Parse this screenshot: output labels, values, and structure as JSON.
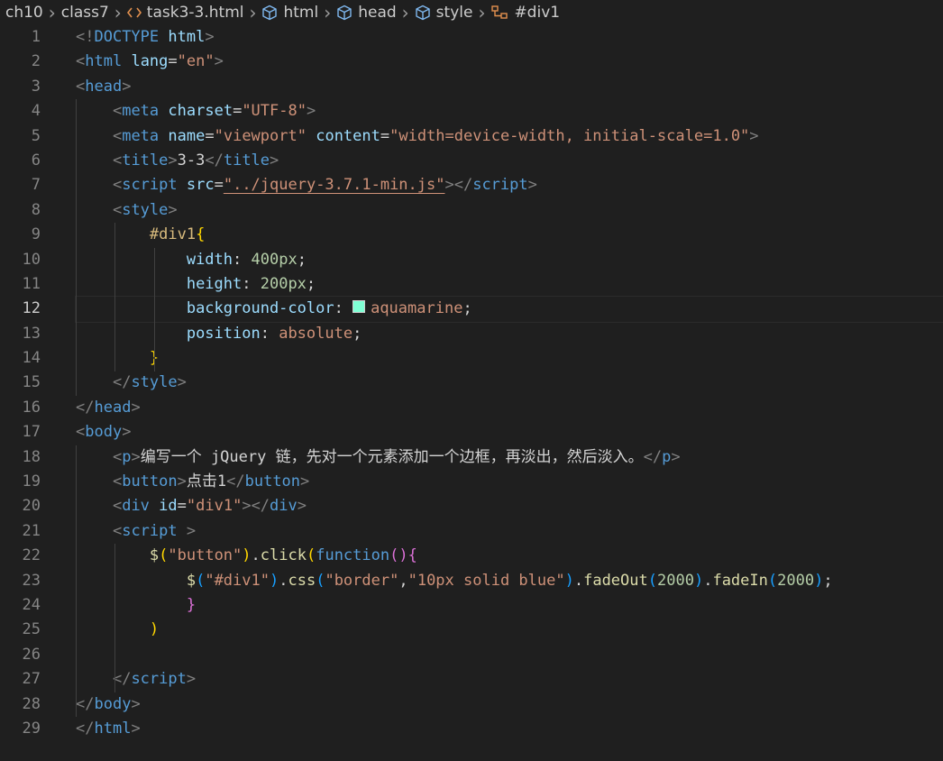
{
  "breadcrumb": {
    "items": [
      "ch10",
      "class7",
      "task3-3.html",
      "html",
      "head",
      "style",
      "#div1"
    ],
    "icons": [
      "",
      "",
      "code-icon",
      "cube-icon",
      "cube-icon",
      "cube-icon",
      "css-selector-icon"
    ]
  },
  "editor": {
    "current_line": 12,
    "swatch_color": "#7fffd4",
    "lines": [
      [
        [
          "pun",
          "<!"
        ],
        [
          "tag",
          "DOCTYPE"
        ],
        [
          "txt",
          " "
        ],
        [
          "attr",
          "html"
        ],
        [
          "pun",
          ">"
        ]
      ],
      [
        [
          "pun",
          "<"
        ],
        [
          "tag",
          "html"
        ],
        [
          "txt",
          " "
        ],
        [
          "attr",
          "lang"
        ],
        [
          "txt",
          "="
        ],
        [
          "str",
          "\"en\""
        ],
        [
          "pun",
          ">"
        ]
      ],
      [
        [
          "pun",
          "<"
        ],
        [
          "tag",
          "head"
        ],
        [
          "pun",
          ">"
        ]
      ],
      [
        [
          "txt",
          "    "
        ],
        [
          "pun",
          "<"
        ],
        [
          "tag",
          "meta"
        ],
        [
          "txt",
          " "
        ],
        [
          "attr",
          "charset"
        ],
        [
          "txt",
          "="
        ],
        [
          "str",
          "\"UTF-8\""
        ],
        [
          "pun",
          ">"
        ]
      ],
      [
        [
          "txt",
          "    "
        ],
        [
          "pun",
          "<"
        ],
        [
          "tag",
          "meta"
        ],
        [
          "txt",
          " "
        ],
        [
          "attr",
          "name"
        ],
        [
          "txt",
          "="
        ],
        [
          "str",
          "\"viewport\""
        ],
        [
          "txt",
          " "
        ],
        [
          "attr",
          "content"
        ],
        [
          "txt",
          "="
        ],
        [
          "str",
          "\"width=device-width, initial-scale=1.0\""
        ],
        [
          "pun",
          ">"
        ]
      ],
      [
        [
          "txt",
          "    "
        ],
        [
          "pun",
          "<"
        ],
        [
          "tag",
          "title"
        ],
        [
          "pun",
          ">"
        ],
        [
          "txt",
          "3-3"
        ],
        [
          "pun",
          "</"
        ],
        [
          "tag",
          "title"
        ],
        [
          "pun",
          ">"
        ]
      ],
      [
        [
          "txt",
          "    "
        ],
        [
          "pun",
          "<"
        ],
        [
          "tag",
          "script"
        ],
        [
          "txt",
          " "
        ],
        [
          "attr",
          "src"
        ],
        [
          "txt",
          "="
        ],
        [
          "link",
          "\"../jquery-3.7.1-min.js\""
        ],
        [
          "pun",
          "></"
        ],
        [
          "tag",
          "script"
        ],
        [
          "pun",
          ">"
        ]
      ],
      [
        [
          "txt",
          "    "
        ],
        [
          "pun",
          "<"
        ],
        [
          "tag",
          "style"
        ],
        [
          "pun",
          ">"
        ]
      ],
      [
        [
          "txt",
          "        "
        ],
        [
          "sel",
          "#div1"
        ],
        [
          "br1",
          "{"
        ]
      ],
      [
        [
          "txt",
          "            "
        ],
        [
          "prop",
          "width"
        ],
        [
          "txt",
          ": "
        ],
        [
          "num",
          "400px"
        ],
        [
          "txt",
          ";"
        ]
      ],
      [
        [
          "txt",
          "            "
        ],
        [
          "prop",
          "height"
        ],
        [
          "txt",
          ": "
        ],
        [
          "num",
          "200px"
        ],
        [
          "txt",
          ";"
        ]
      ],
      [
        [
          "txt",
          "            "
        ],
        [
          "prop",
          "background-color"
        ],
        [
          "txt",
          ": "
        ],
        [
          "swatch",
          ""
        ],
        [
          "val",
          "aquamarine"
        ],
        [
          "txt",
          ";"
        ]
      ],
      [
        [
          "txt",
          "            "
        ],
        [
          "prop",
          "position"
        ],
        [
          "txt",
          ": "
        ],
        [
          "val",
          "absolute"
        ],
        [
          "txt",
          ";"
        ]
      ],
      [
        [
          "txt",
          "        "
        ],
        [
          "br1",
          "}"
        ]
      ],
      [
        [
          "txt",
          "    "
        ],
        [
          "pun",
          "</"
        ],
        [
          "tag",
          "style"
        ],
        [
          "pun",
          ">"
        ]
      ],
      [
        [
          "pun",
          "</"
        ],
        [
          "tag",
          "head"
        ],
        [
          "pun",
          ">"
        ]
      ],
      [
        [
          "pun",
          "<"
        ],
        [
          "tag",
          "body"
        ],
        [
          "pun",
          ">"
        ]
      ],
      [
        [
          "txt",
          "    "
        ],
        [
          "pun",
          "<"
        ],
        [
          "tag",
          "p"
        ],
        [
          "pun",
          ">"
        ],
        [
          "txt",
          "编写一个 jQuery 链，先对一个元素添加一个边框，再淡出，然后淡入。"
        ],
        [
          "pun",
          "</"
        ],
        [
          "tag",
          "p"
        ],
        [
          "pun",
          ">"
        ]
      ],
      [
        [
          "txt",
          "    "
        ],
        [
          "pun",
          "<"
        ],
        [
          "tag",
          "button"
        ],
        [
          "pun",
          ">"
        ],
        [
          "txt",
          "点击1"
        ],
        [
          "pun",
          "</"
        ],
        [
          "tag",
          "button"
        ],
        [
          "pun",
          ">"
        ]
      ],
      [
        [
          "txt",
          "    "
        ],
        [
          "pun",
          "<"
        ],
        [
          "tag",
          "div"
        ],
        [
          "txt",
          " "
        ],
        [
          "attr",
          "id"
        ],
        [
          "txt",
          "="
        ],
        [
          "str",
          "\"div1\""
        ],
        [
          "pun",
          "></"
        ],
        [
          "tag",
          "div"
        ],
        [
          "pun",
          ">"
        ]
      ],
      [
        [
          "txt",
          "    "
        ],
        [
          "pun",
          "<"
        ],
        [
          "tag",
          "script"
        ],
        [
          "txt",
          " "
        ],
        [
          "pun",
          ">"
        ]
      ],
      [
        [
          "txt",
          "        "
        ],
        [
          "fn",
          "$"
        ],
        [
          "br1",
          "("
        ],
        [
          "str",
          "\"button\""
        ],
        [
          "br1",
          ")"
        ],
        [
          "txt",
          "."
        ],
        [
          "fn",
          "click"
        ],
        [
          "br1",
          "("
        ],
        [
          "kw",
          "function"
        ],
        [
          "br2",
          "()"
        ],
        [
          "br2",
          "{"
        ]
      ],
      [
        [
          "txt",
          "            "
        ],
        [
          "fn",
          "$"
        ],
        [
          "br3",
          "("
        ],
        [
          "str",
          "\"#div1\""
        ],
        [
          "br3",
          ")"
        ],
        [
          "txt",
          "."
        ],
        [
          "fn",
          "css"
        ],
        [
          "br3",
          "("
        ],
        [
          "str",
          "\"border\""
        ],
        [
          "txt",
          ","
        ],
        [
          "str",
          "\"10px solid blue\""
        ],
        [
          "br3",
          ")"
        ],
        [
          "txt",
          "."
        ],
        [
          "fn",
          "fadeOut"
        ],
        [
          "br3",
          "("
        ],
        [
          "num",
          "2000"
        ],
        [
          "br3",
          ")"
        ],
        [
          "txt",
          "."
        ],
        [
          "fn",
          "fadeIn"
        ],
        [
          "br3",
          "("
        ],
        [
          "num",
          "2000"
        ],
        [
          "br3",
          ")"
        ],
        [
          "txt",
          ";"
        ]
      ],
      [
        [
          "txt",
          "            "
        ],
        [
          "br2",
          "}"
        ]
      ],
      [
        [
          "txt",
          "        "
        ],
        [
          "br1",
          ")"
        ]
      ],
      [
        [
          "txt",
          ""
        ]
      ],
      [
        [
          "txt",
          "    "
        ],
        [
          "pun",
          "</"
        ],
        [
          "tag",
          "script"
        ],
        [
          "pun",
          ">"
        ]
      ],
      [
        [
          "pun",
          "</"
        ],
        [
          "tag",
          "body"
        ],
        [
          "pun",
          ">"
        ]
      ],
      [
        [
          "pun",
          "</"
        ],
        [
          "tag",
          "html"
        ],
        [
          "pun",
          ">"
        ]
      ]
    ]
  }
}
